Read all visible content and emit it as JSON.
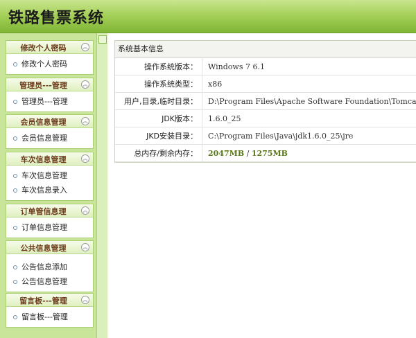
{
  "header": {
    "title": "铁路售票系统"
  },
  "sidebar": {
    "groups": [
      {
        "title": "修改个人密码",
        "items": [
          "修改个人密码"
        ]
      },
      {
        "title": "管理员---管理",
        "items": [
          "管理员---管理"
        ]
      },
      {
        "title": "会员信息管理",
        "items": [
          "会员信息管理"
        ]
      },
      {
        "title": "车次信息管理",
        "items": [
          "车次信息管理",
          "车次信息录入"
        ]
      },
      {
        "title": "订单管信息理",
        "items": [
          "订单信息管理"
        ]
      },
      {
        "title": "公共信息管理",
        "items": [
          "公告信息添加",
          "公告信息管理"
        ]
      },
      {
        "title": "留言板---管理",
        "items": [
          "留言板---管理"
        ]
      }
    ]
  },
  "main": {
    "panel_title": "系统基本信息",
    "rows": [
      {
        "label": "操作系统版本：",
        "value": "Windows 7  6.1"
      },
      {
        "label": "操作系统类型：",
        "value": "x86"
      },
      {
        "label": "用户,目录,临时目录：",
        "value": "D:\\Program Files\\Apache Software Foundation\\Tomcat"
      },
      {
        "label": "JDK版本：",
        "value": "1.6.0_25"
      },
      {
        "label": "JKD安装目录：",
        "value": "C:\\Program Files\\Java\\jdk1.6.0_25\\jre"
      }
    ],
    "memory": {
      "label": "总内存/剩余内存：",
      "total": "2047MB",
      "separator": " / ",
      "free": "1275MB"
    }
  }
}
